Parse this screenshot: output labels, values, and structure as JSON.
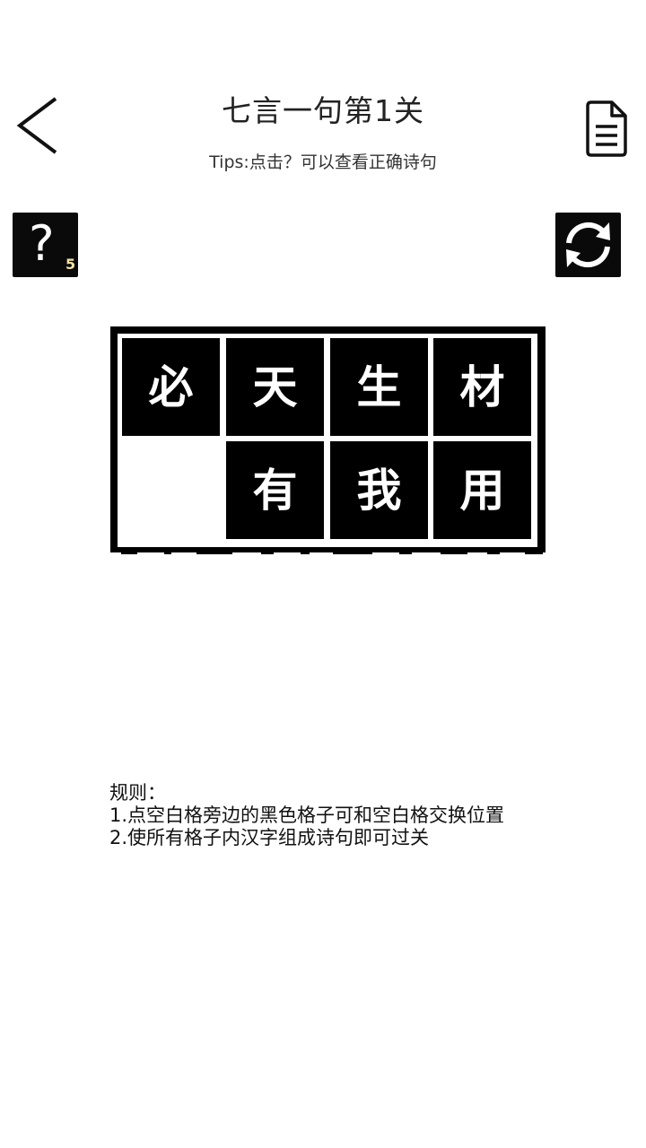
{
  "header": {
    "title": "七言一句第1关",
    "tips": "Tips:点击？可以查看正确诗句"
  },
  "icons": {
    "back": "chevron-left-icon",
    "document": "document-icon",
    "hint": "question-mark-icon",
    "refresh": "refresh-icon"
  },
  "hint": {
    "symbol": "?",
    "count": "5"
  },
  "board": {
    "rows": [
      [
        "必",
        "天",
        "生",
        "材"
      ],
      [
        "",
        "有",
        "我",
        "用"
      ]
    ],
    "colors": {
      "tile": "#000000",
      "blank": "#ffffff",
      "text": "#ffffff",
      "hint_count": "#f3e2a0"
    }
  },
  "rules": {
    "heading": "规则：",
    "lines": [
      "1.点空白格旁边的黑色格子可和空白格交换位置",
      "2.使所有格子内汉字组成诗句即可过关"
    ]
  }
}
